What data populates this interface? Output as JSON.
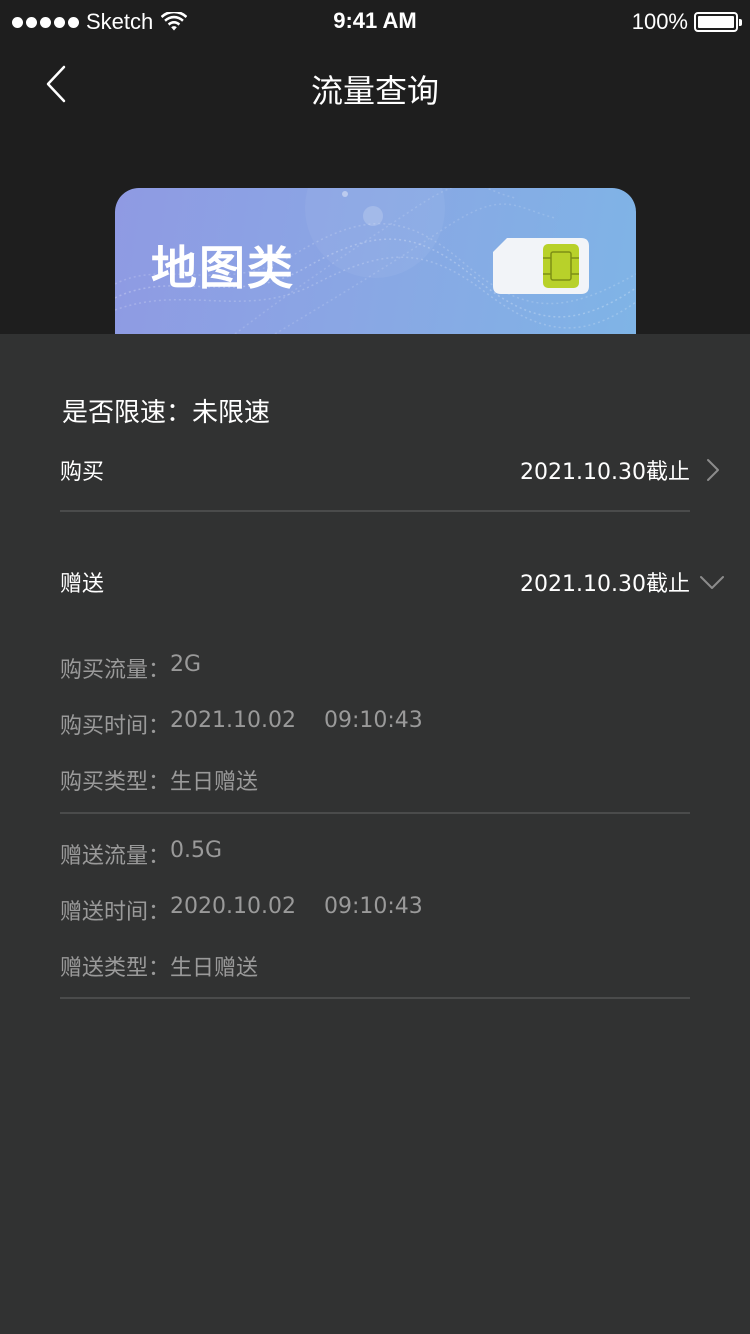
{
  "status_bar": {
    "carrier": "Sketch",
    "time": "9:41 AM",
    "battery": "100%"
  },
  "nav": {
    "title": "流量查询"
  },
  "card": {
    "name": "地图类"
  },
  "speed": {
    "label": "是否限速：",
    "value": "未限速"
  },
  "purchase": {
    "label": "购买",
    "expiry": "2021.10.30截止"
  },
  "gift": {
    "label": "赠送",
    "expiry": "2021.10.30截止"
  },
  "purchase_details": [
    {
      "label": "购买流量：",
      "value": "2G"
    },
    {
      "label": "购买时间：",
      "value": "2021.10.02    09:10:43"
    },
    {
      "label": "购买类型：",
      "value": "生日赠送"
    }
  ],
  "gift_details": [
    {
      "label": "赠送流量：",
      "value": "0.5G"
    },
    {
      "label": "赠送时间：",
      "value": "2020.10.02    09:10:43"
    },
    {
      "label": "赠送类型：",
      "value": "生日赠送"
    }
  ],
  "icons": {
    "back": "chevron-left-icon",
    "purchase_arrow": "chevron-right-icon",
    "gift_arrow": "chevron-down-icon",
    "sim": "sim-card-icon",
    "wifi": "wifi-icon",
    "battery": "battery-icon"
  },
  "colors": {
    "header_bg": "#1e1e1e",
    "panel_bg": "#313232",
    "card_gradient_start": "#8f9ae3",
    "card_gradient_end": "#7fb4e6",
    "detail_text": "#9a9a9a",
    "chip": "#b8d12a"
  }
}
